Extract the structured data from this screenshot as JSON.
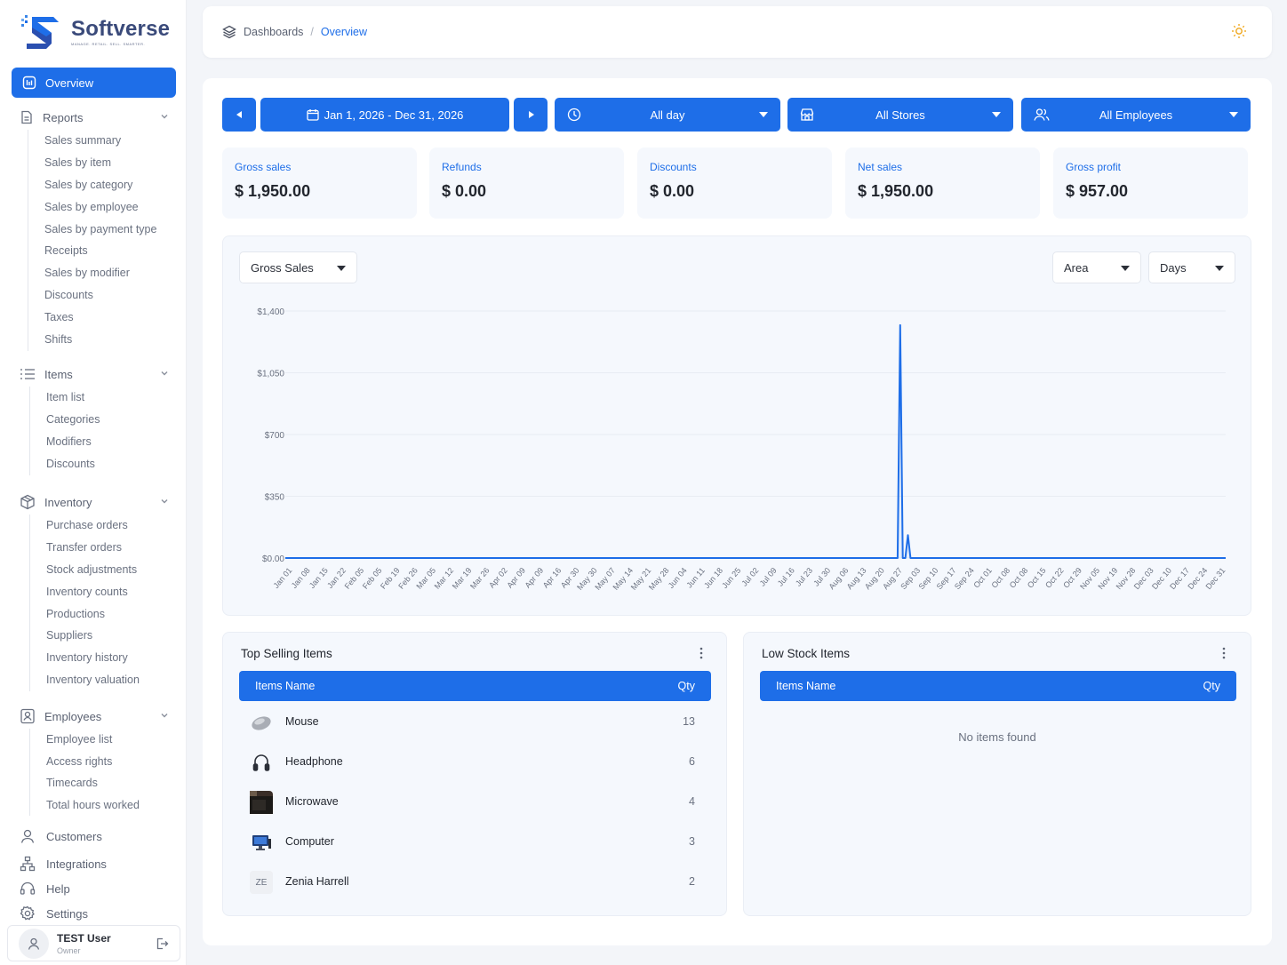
{
  "brand": {
    "name": "Softverse",
    "tagline": "Manage. Retail. Sell. Smarter."
  },
  "nav": {
    "overview": "Overview",
    "reports": {
      "label": "Reports",
      "items": [
        "Sales summary",
        "Sales by item",
        "Sales by category",
        "Sales by employee",
        "Sales by payment type",
        "Receipts",
        "Sales by modifier",
        "Discounts",
        "Taxes",
        "Shifts"
      ]
    },
    "items": {
      "label": "Items",
      "items": [
        "Item list",
        "Categories",
        "Modifiers",
        "Discounts"
      ]
    },
    "inventory": {
      "label": "Inventory",
      "items": [
        "Purchase orders",
        "Transfer orders",
        "Stock adjustments",
        "Inventory counts",
        "Productions",
        "Suppliers",
        "Inventory history",
        "Inventory valuation"
      ]
    },
    "employees": {
      "label": "Employees",
      "items": [
        "Employee list",
        "Access rights",
        "Timecards",
        "Total hours worked"
      ]
    },
    "customers": "Customers",
    "integrations": "Integrations",
    "help": "Help",
    "settings": "Settings"
  },
  "user": {
    "name": "TEST User",
    "role": "Owner"
  },
  "breadcrumb": {
    "parent": "Dashboards",
    "separator": "/",
    "current": "Overview"
  },
  "filters": {
    "date_range": "Jan 1, 2026 - Dec 31, 2026",
    "time": "All day",
    "stores": "All Stores",
    "employees": "All Employees"
  },
  "kpis": [
    {
      "label": "Gross sales",
      "value": "$ 1,950.00"
    },
    {
      "label": "Refunds",
      "value": "$ 0.00"
    },
    {
      "label": "Discounts",
      "value": "$ 0.00"
    },
    {
      "label": "Net sales",
      "value": "$ 1,950.00"
    },
    {
      "label": "Gross profit",
      "value": "$ 957.00"
    }
  ],
  "chart_controls": {
    "metric": "Gross Sales",
    "type": "Area",
    "period": "Days"
  },
  "chart_data": {
    "type": "area",
    "title": "",
    "xlabel": "",
    "ylabel": "",
    "ylim": [
      0,
      1400
    ],
    "yticks": [
      0,
      350,
      700,
      1050,
      1400
    ],
    "ytick_labels": [
      "$0.00",
      "$350",
      "$700",
      "$1,050",
      "$1,400"
    ],
    "xlim": [
      "2026-01-01",
      "2026-12-31"
    ],
    "xtick_labels": [
      "Jan 01",
      "Jan 08",
      "Jan 15",
      "Jan 22",
      "Feb 05",
      "Feb 05",
      "Feb 19",
      "Feb 26",
      "Mar 05",
      "Mar 12",
      "Mar 19",
      "Mar 26",
      "Apr 02",
      "Apr 09",
      "Apr 09",
      "Apr 16",
      "Apr 30",
      "May 30",
      "May 07",
      "May 14",
      "May 21",
      "May 28",
      "Jun 04",
      "Jun 11",
      "Jun 18",
      "Jun 25",
      "Jul 02",
      "Jul 09",
      "Jul 16",
      "Jul 23",
      "Jul 30",
      "Aug 06",
      "Aug 13",
      "Aug 20",
      "Aug 27",
      "Sep 03",
      "Sep 10",
      "Sep 17",
      "Sep 24",
      "Oct 01",
      "Oct 08",
      "Oct 08",
      "Oct 15",
      "Oct 22",
      "Oct 29",
      "Nov 05",
      "Nov 19",
      "Nov 28",
      "Dec 03",
      "Dec 10",
      "Dec 17",
      "Dec 24",
      "Dec 31"
    ],
    "grid": true,
    "series": [
      {
        "color": "#1e6ee8",
        "points": [
          {
            "x": "2026-01-01",
            "y": 0
          },
          {
            "x": "2026-08-26",
            "y": 0
          },
          {
            "x": "2026-08-27",
            "y": 1320
          },
          {
            "x": "2026-08-28",
            "y": 0
          },
          {
            "x": "2026-08-29",
            "y": 0
          },
          {
            "x": "2026-08-30",
            "y": 130
          },
          {
            "x": "2026-08-31",
            "y": 0
          },
          {
            "x": "2026-12-31",
            "y": 0
          }
        ]
      }
    ]
  },
  "top_selling": {
    "title": "Top Selling Items",
    "col_name": "Items Name",
    "col_qty": "Qty",
    "rows": [
      {
        "name": "Mouse",
        "qty": "13",
        "icon": "mouse-icon"
      },
      {
        "name": "Headphone",
        "qty": "6",
        "icon": "headphone-icon"
      },
      {
        "name": "Microwave",
        "qty": "4",
        "icon": "microwave-icon"
      },
      {
        "name": "Computer",
        "qty": "3",
        "icon": "computer-icon"
      },
      {
        "name": "Zenia Harrell",
        "qty": "2",
        "initials": "ZE"
      }
    ]
  },
  "low_stock": {
    "title": "Low Stock Items",
    "col_name": "Items Name",
    "col_qty": "Qty",
    "empty": "No items found"
  },
  "colors": {
    "accent": "#1e6ee8",
    "card_bg": "#f5f8fd",
    "page_bg": "#f3f5f9"
  }
}
